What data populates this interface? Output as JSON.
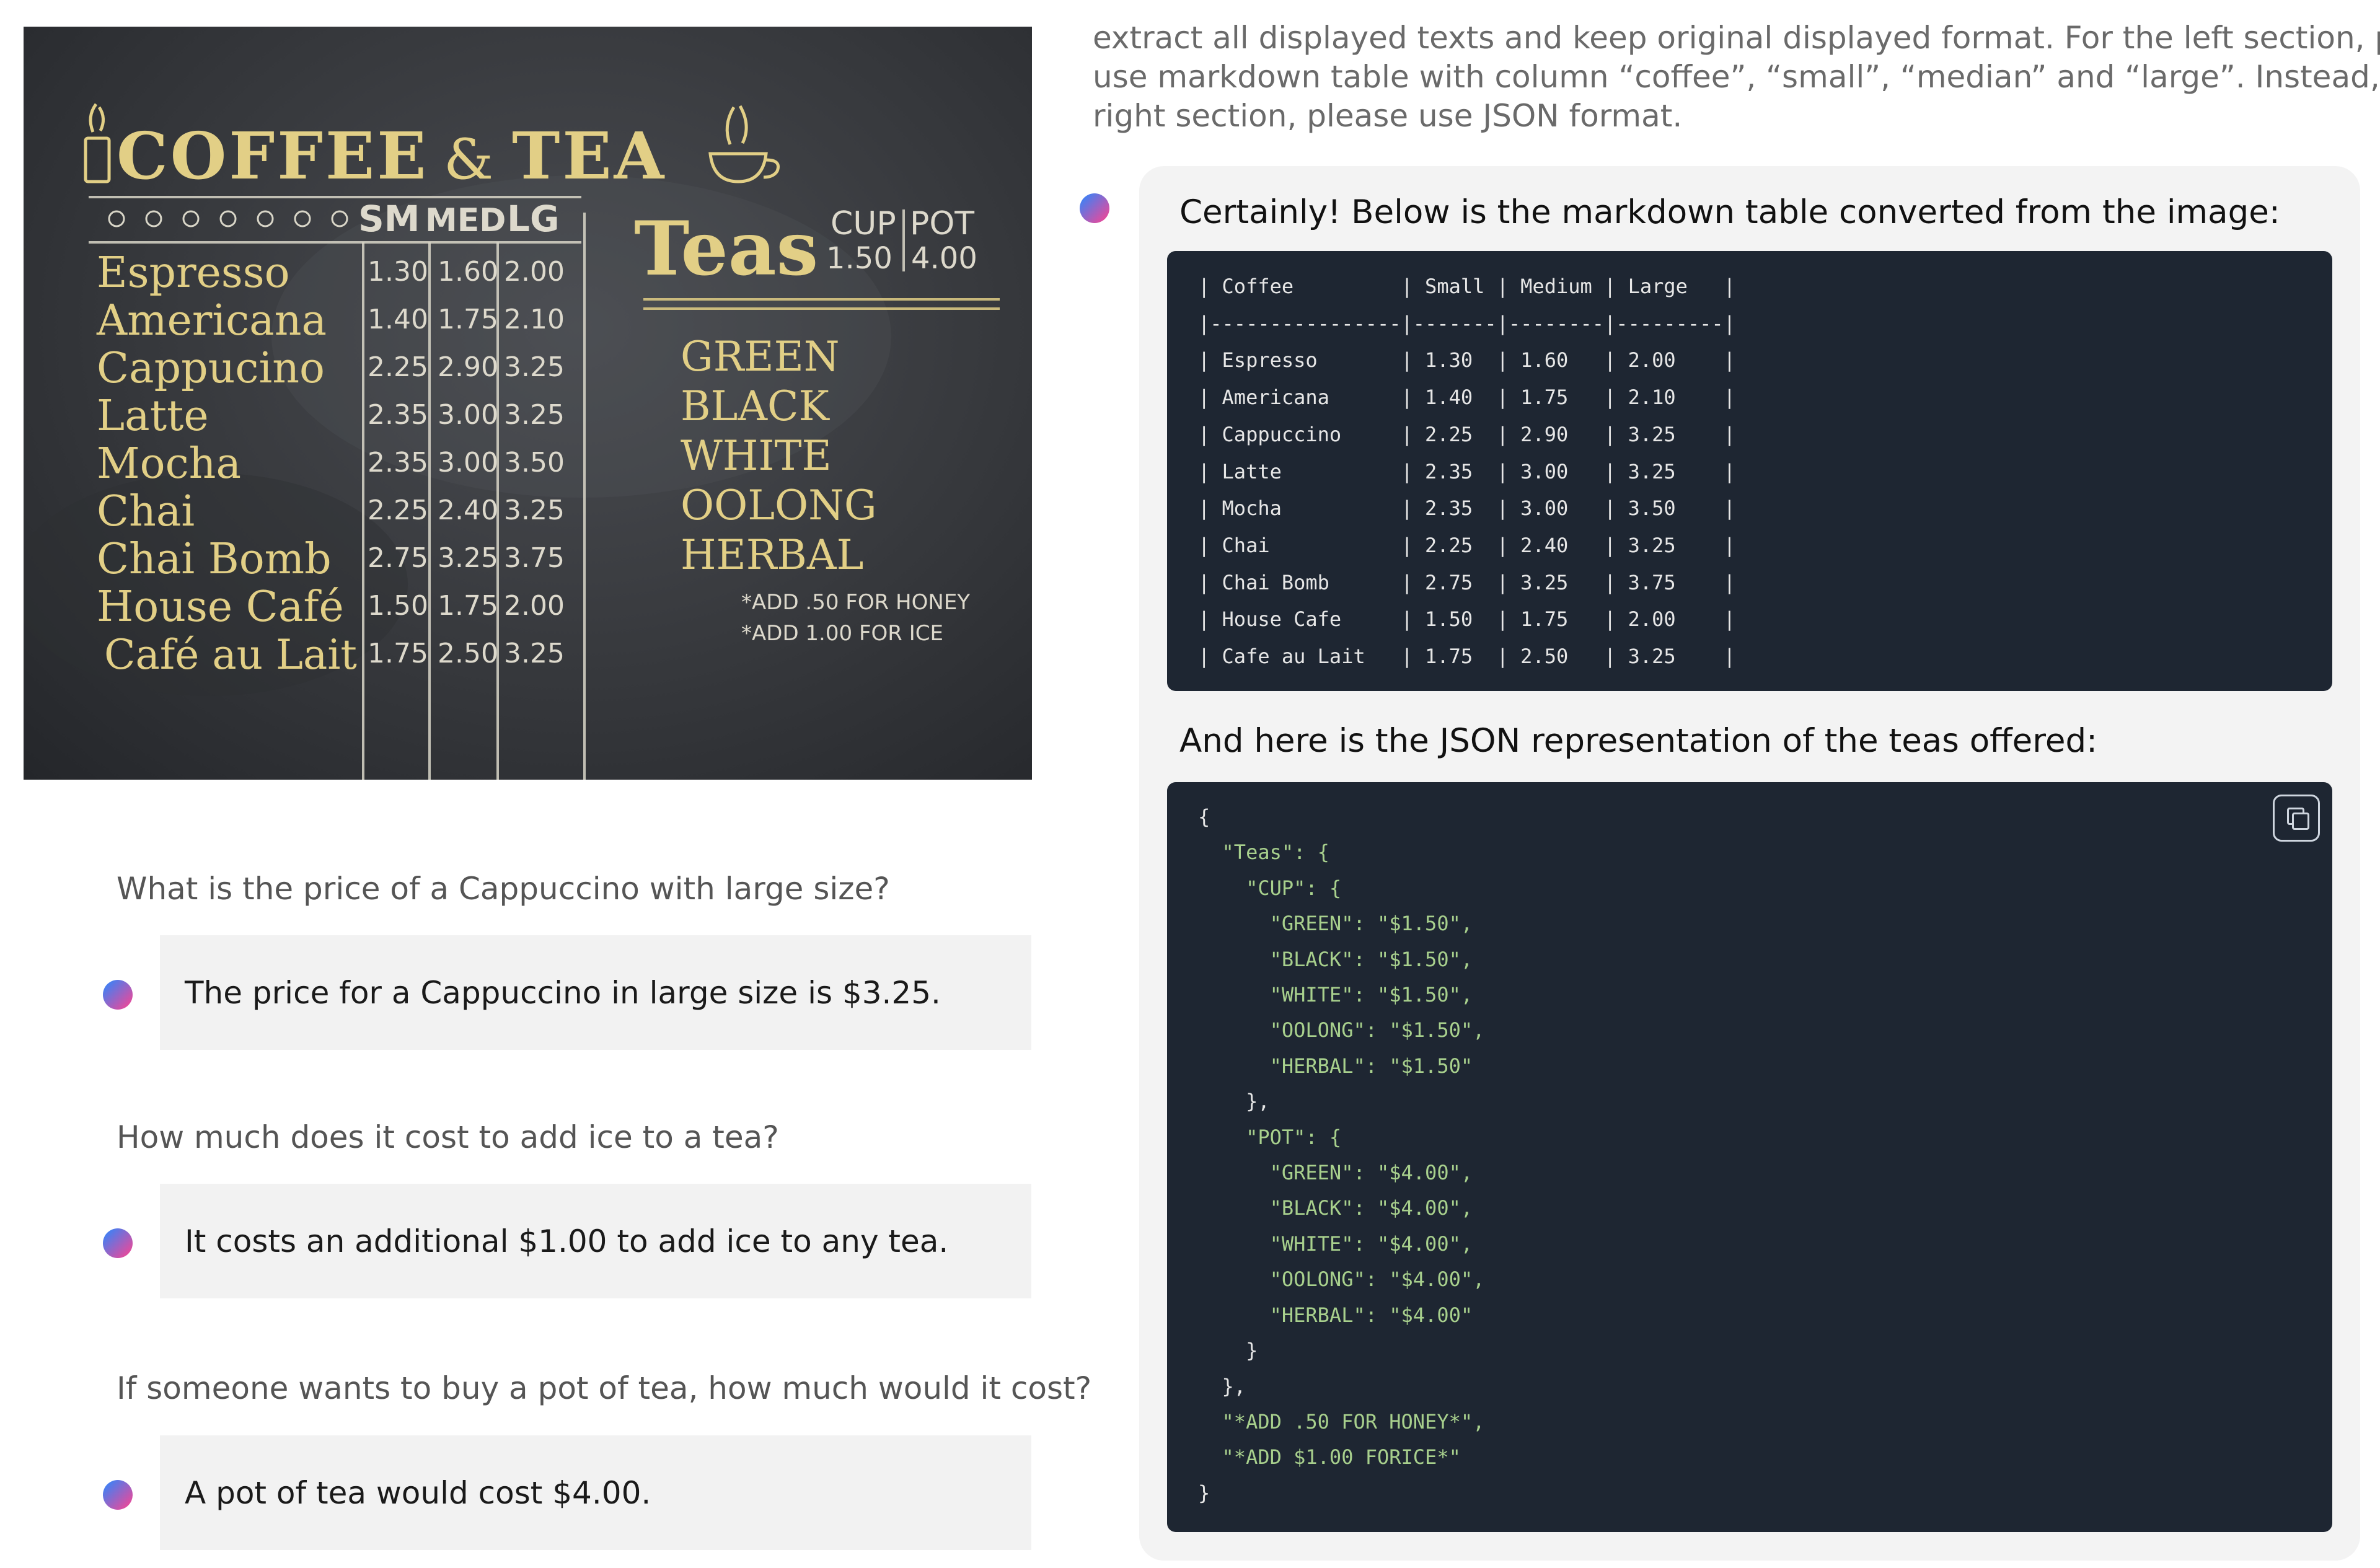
{
  "board": {
    "title_left": "COFFEE",
    "title_amp": "&",
    "title_right": "TEA",
    "size_headers": [
      "SM",
      "MED",
      "LG"
    ],
    "coffee_rows": [
      {
        "name": "Espresso",
        "sm": "1.30",
        "med": "1.60",
        "lg": "2.00"
      },
      {
        "name": "Americana",
        "sm": "1.40",
        "med": "1.75",
        "lg": "2.10"
      },
      {
        "name": "Cappucino",
        "sm": "2.25",
        "med": "2.90",
        "lg": "3.25"
      },
      {
        "name": "Latte",
        "sm": "2.35",
        "med": "3.00",
        "lg": "3.25"
      },
      {
        "name": "Mocha",
        "sm": "2.35",
        "med": "3.00",
        "lg": "3.50"
      },
      {
        "name": "Chai",
        "sm": "2.25",
        "med": "2.40",
        "lg": "3.25"
      },
      {
        "name": "Chai Bomb",
        "sm": "2.75",
        "med": "3.25",
        "lg": "3.75"
      },
      {
        "name": "House Café",
        "sm": "1.50",
        "med": "1.75",
        "lg": "2.00"
      },
      {
        "name": "Café au Lait",
        "sm": "1.75",
        "med": "2.50",
        "lg": "3.25"
      }
    ],
    "teas_title": "Teas",
    "cup_label": "CUP",
    "pot_label": "POT",
    "cup_price": "1.50",
    "pot_price": "4.00",
    "tea_list": [
      "GREEN",
      "BLACK",
      "WHITE",
      "OOLONG",
      "HERBAL"
    ],
    "note_honey": "*ADD .50 FOR HONEY",
    "note_ice": "*ADD 1.00 FOR ICE"
  },
  "qa": [
    {
      "question": "What is the price of a Cappuccino with large size?",
      "answer": "The price for a Cappuccino in large size is $3.25."
    },
    {
      "question": "How much does it cost to add ice to a tea?",
      "answer": "It costs an additional $1.00 to add ice to any tea."
    },
    {
      "question": "If someone wants to buy a pot of tea, how much would it cost?",
      "answer": "A pot of tea would cost $4.00."
    }
  ],
  "prompt_lines": [
    "extract all displayed texts and keep original displayed format. For the left section, please",
    "use markdown table with column “coffee”, “small”, “median” and “large”. Instead, for the",
    "right section, please use JSON format."
  ],
  "reply": {
    "intro": "Certainly! Below is the markdown table converted from the image:",
    "markdown_lines": [
      "| Coffee         | Small | Medium | Large   |",
      "|----------------|-------|--------|---------|",
      "| Espresso       | 1.30  | 1.60   | 2.00    |",
      "| Americana      | 1.40  | 1.75   | 2.10    |",
      "| Cappuccino     | 2.25  | 2.90   | 3.25    |",
      "| Latte          | 2.35  | 3.00   | 3.25    |",
      "| Mocha          | 2.35  | 3.00   | 3.50    |",
      "| Chai           | 2.25  | 2.40   | 3.25    |",
      "| Chai Bomb      | 2.75  | 3.25   | 3.75    |",
      "| House Cafe     | 1.50  | 1.75   | 2.00    |",
      "| Cafe au Lait   | 1.75  | 2.50   | 3.25    |"
    ],
    "json_intro": "And here is the JSON representation of the teas offered:",
    "json_lines": [
      "{",
      "  \"Teas\": {",
      "    \"CUP\": {",
      "      \"GREEN\": \"$1.50\",",
      "      \"BLACK\": \"$1.50\",",
      "      \"WHITE\": \"$1.50\",",
      "      \"OOLONG\": \"$1.50\",",
      "      \"HERBAL\": \"$1.50\"",
      "    },",
      "    \"POT\": {",
      "      \"GREEN\": \"$4.00\",",
      "      \"BLACK\": \"$4.00\",",
      "      \"WHITE\": \"$4.00\",",
      "      \"OOLONG\": \"$4.00\",",
      "      \"HERBAL\": \"$4.00\"",
      "    }",
      "  },",
      "  \"*ADD .50 FOR HONEY*\",",
      "  \"*ADD $1.00 FORICE*\"",
      "}"
    ]
  },
  "colors": {
    "accent_dot_start": "#3b82f6",
    "accent_dot_end": "#ec4899",
    "code_bg": "#1e2632",
    "json_string": "#a8d08d",
    "chalk_yellow": "#e2cf86"
  },
  "icons": {
    "copy": "copy-icon",
    "avatar": "assistant-avatar-icon",
    "coffee_cup": "coffee-cup-icon",
    "teacup": "teacup-icon"
  }
}
